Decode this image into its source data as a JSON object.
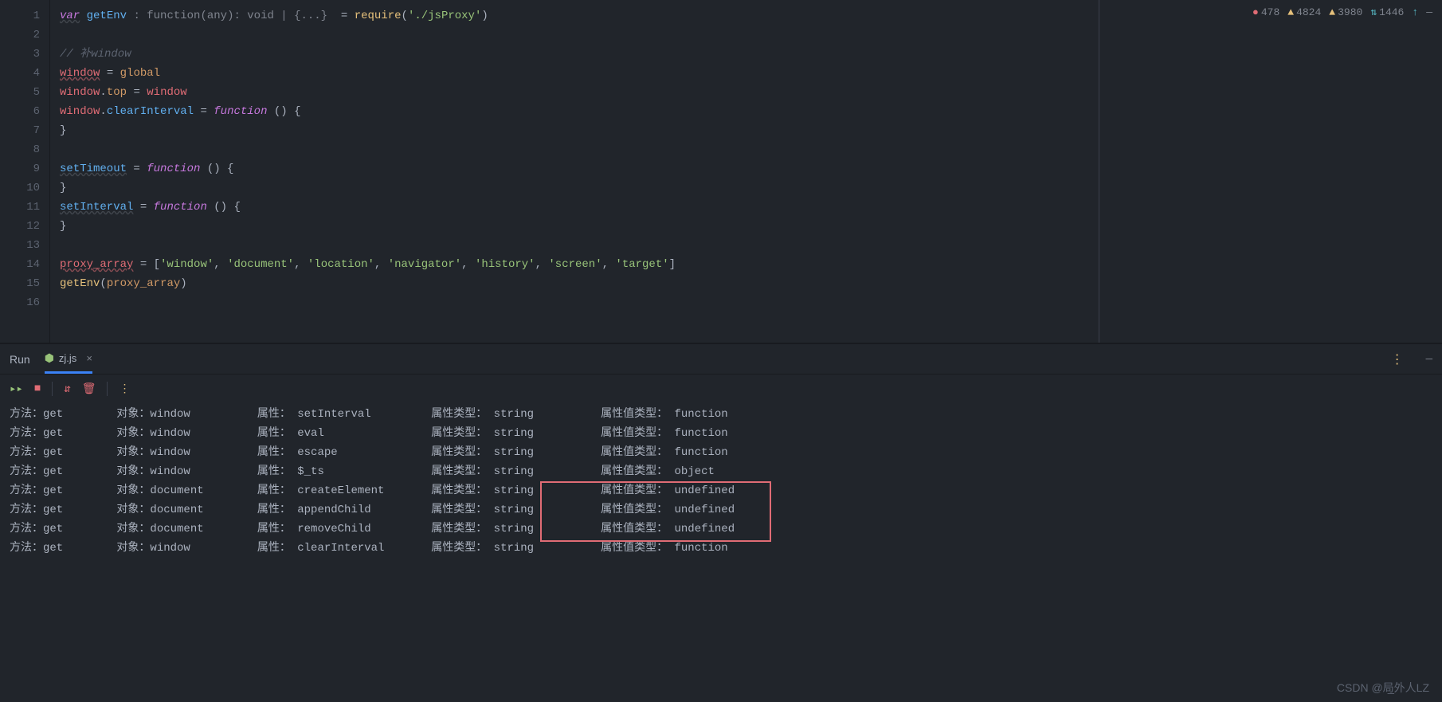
{
  "editor": {
    "lines": [
      "1",
      "2",
      "3",
      "4",
      "5",
      "6",
      "7",
      "8",
      "9",
      "10",
      "11",
      "12",
      "13",
      "14",
      "15",
      "16"
    ],
    "code": {
      "l1_var": "var",
      "l1_name": "getEnv",
      "l1_type": " : function(any): void | {...} ",
      "l1_eq": " = ",
      "l1_req": "require",
      "l1_paren_open": "(",
      "l1_str": "'./jsProxy'",
      "l1_paren_close": ")",
      "l3": "// 补window",
      "l4_window": "window",
      "l4_eq": " = ",
      "l4_global": "global",
      "l5_window": "window",
      "l5_dot": ".",
      "l5_top": "top",
      "l5_eq": " = ",
      "l5_window2": "window",
      "l6_window": "window",
      "l6_dot": ".",
      "l6_clear": "clearInterval",
      "l6_eq": " = ",
      "l6_func": "function",
      "l6_rest": " () {",
      "l7": "}",
      "l9_set": "setTimeout",
      "l9_eq": " = ",
      "l9_func": "function",
      "l9_rest": " () {",
      "l10": "}",
      "l11_set": "setInterval",
      "l11_eq": " = ",
      "l11_func": "function",
      "l11_rest": " () {",
      "l12": "}",
      "l14_proxy": "proxy_array",
      "l14_eq": " = [",
      "l14_s1": "'window'",
      "l14_c": ", ",
      "l14_s2": "'document'",
      "l14_s3": "'location'",
      "l14_s4": "'navigator'",
      "l14_s5": "'history'",
      "l14_s6": "'screen'",
      "l14_s7": "'target'",
      "l14_close": "]",
      "l15_get": "getEnv",
      "l15_open": "(",
      "l15_arg": "proxy_array",
      "l15_close": ")"
    }
  },
  "status": {
    "errors": "478",
    "warn1": "4824",
    "warn2": "3980",
    "info": "1446"
  },
  "run": {
    "label": "Run",
    "tab_name": "zj.js"
  },
  "labels": {
    "method": "方法：",
    "object": "对象：",
    "attr": "属性：",
    "attr_type": "属性类型：",
    "attr_val_type": "属性值类型："
  },
  "console_rows": [
    {
      "method": "get",
      "object": "window",
      "attr": "setInterval",
      "atype": "string",
      "avtype": "function"
    },
    {
      "method": "get",
      "object": "window",
      "attr": "eval",
      "atype": "string",
      "avtype": "function"
    },
    {
      "method": "get",
      "object": "window",
      "attr": "escape",
      "atype": "string",
      "avtype": "function"
    },
    {
      "method": "get",
      "object": "window",
      "attr": "$_ts",
      "atype": "string",
      "avtype": "object"
    },
    {
      "method": "get",
      "object": "document",
      "attr": "createElement",
      "atype": "string",
      "avtype": "undefined"
    },
    {
      "method": "get",
      "object": "document",
      "attr": "appendChild",
      "atype": "string",
      "avtype": "undefined"
    },
    {
      "method": "get",
      "object": "document",
      "attr": "removeChild",
      "atype": "string",
      "avtype": "undefined"
    },
    {
      "method": "get",
      "object": "window",
      "attr": "clearInterval",
      "atype": "string",
      "avtype": "function"
    }
  ],
  "watermark": "CSDN @局外人LZ"
}
